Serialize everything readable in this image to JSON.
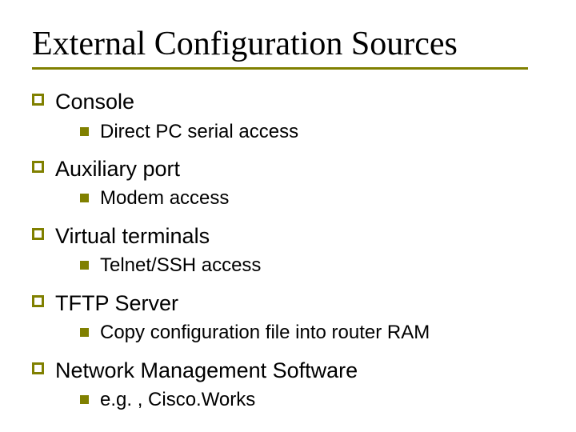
{
  "slide": {
    "title": "External Configuration Sources",
    "items": [
      {
        "label": "Console",
        "children": [
          {
            "label": "Direct PC serial access"
          }
        ]
      },
      {
        "label": "Auxiliary port",
        "children": [
          {
            "label": "Modem access"
          }
        ]
      },
      {
        "label": "Virtual terminals",
        "children": [
          {
            "label": "Telnet/SSH access"
          }
        ]
      },
      {
        "label": "TFTP Server",
        "children": [
          {
            "label": "Copy configuration file into router RAM"
          }
        ]
      },
      {
        "label": "Network Management Software",
        "children": [
          {
            "label": "e.g. , Cisco.Works"
          }
        ]
      }
    ]
  }
}
